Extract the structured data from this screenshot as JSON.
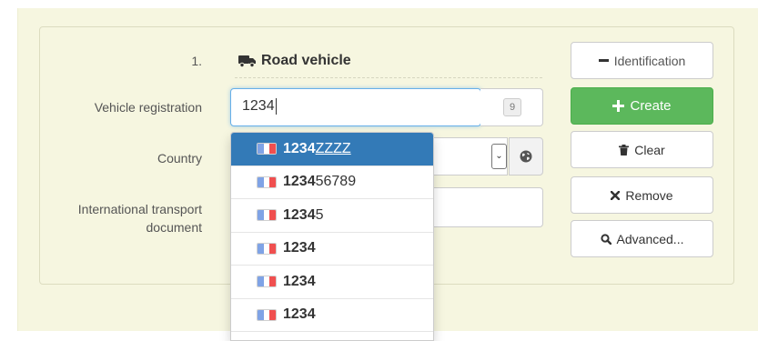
{
  "section": {
    "number": "1.",
    "title": "Road vehicle",
    "icon": "truck-icon"
  },
  "fields": {
    "registration": {
      "label": "Vehicle registration",
      "value": "1234",
      "counter": "9"
    },
    "country": {
      "label": "Country",
      "value": ""
    },
    "itd": {
      "label_line1": "International transport",
      "label_line2": "document",
      "value": ""
    }
  },
  "suggestions": [
    {
      "match": "1234",
      "rest": "ZZZZ",
      "flag": "france-flag-icon",
      "active": true
    },
    {
      "match": "1234",
      "rest": "56789",
      "flag": "france-flag-icon",
      "active": false
    },
    {
      "match": "1234",
      "rest": "5",
      "flag": "france-flag-icon",
      "active": false
    },
    {
      "match": "1234",
      "rest": "",
      "flag": "france-flag-icon",
      "active": false
    },
    {
      "match": "1234",
      "rest": "",
      "flag": "france-flag-icon",
      "active": false
    },
    {
      "match": "1234",
      "rest": "",
      "flag": "france-flag-icon",
      "active": false
    }
  ],
  "buttons": {
    "identification": "Identification",
    "create": "Create",
    "clear": "Clear",
    "remove": "Remove",
    "advanced": "Advanced..."
  },
  "colors": {
    "primary": "#337ab7",
    "success": "#5cb85c",
    "panel_bg": "#f6f6e0"
  }
}
